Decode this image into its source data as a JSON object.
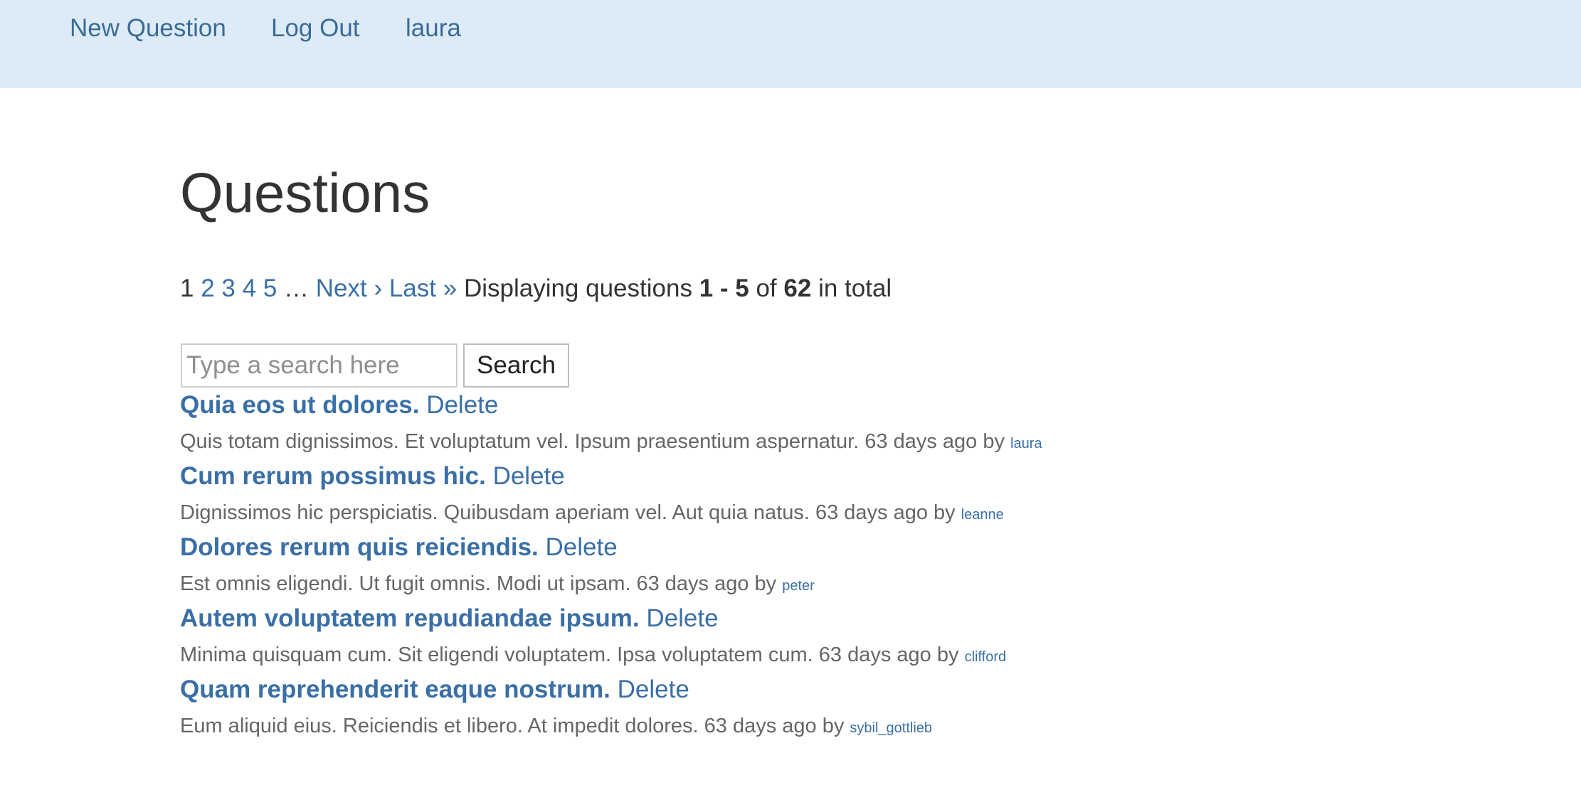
{
  "nav": {
    "new_question": "New Question",
    "log_out": "Log Out",
    "username": "laura"
  },
  "page": {
    "title": "Questions"
  },
  "pagination": {
    "current": "1",
    "pages": [
      "2",
      "3",
      "4",
      "5"
    ],
    "gap": "…",
    "next": "Next ›",
    "last": "Last »",
    "info_prefix": "Displaying questions",
    "range": "1 - 5",
    "info_of": "of",
    "total": "62",
    "info_suffix": "in total"
  },
  "search": {
    "placeholder": "Type a search here",
    "value": "",
    "button_label": "Search"
  },
  "questions": [
    {
      "title": "Quia eos ut dolores.",
      "delete_label": "Delete",
      "body": "Quis totam dignissimos. Et voluptatum vel. Ipsum praesentium aspernatur. 63 days ago by",
      "author": "laura"
    },
    {
      "title": "Cum rerum possimus hic.",
      "delete_label": "Delete",
      "body": "Dignissimos hic perspiciatis. Quibusdam aperiam vel. Aut quia natus. 63 days ago by",
      "author": "leanne"
    },
    {
      "title": "Dolores rerum quis reiciendis.",
      "delete_label": "Delete",
      "body": "Est omnis eligendi. Ut fugit omnis. Modi ut ipsam. 63 days ago by",
      "author": "peter"
    },
    {
      "title": "Autem voluptatem repudiandae ipsum.",
      "delete_label": "Delete",
      "body": "Minima quisquam cum. Sit eligendi voluptatem. Ipsa voluptatem cum. 63 days ago by",
      "author": "clifford"
    },
    {
      "title": "Quam reprehenderit eaque nostrum.",
      "delete_label": "Delete",
      "body": "Eum aliquid eius. Reiciendis et libero. At impedit dolores. 63 days ago by",
      "author": "sybil_gottlieb"
    }
  ],
  "colors": {
    "navbar_bg": "#ddebf6",
    "link": "#3a6fa6",
    "text": "#333333",
    "muted_text": "#666666"
  }
}
